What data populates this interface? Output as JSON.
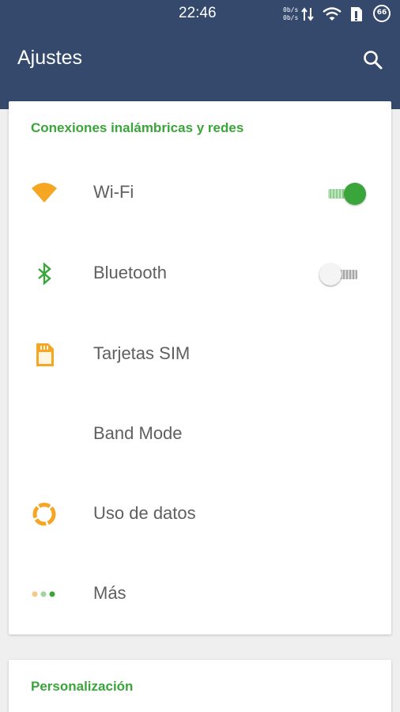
{
  "status_bar": {
    "time": "22:46",
    "net_up": "0b/s",
    "net_down": "0b/s",
    "battery": "66"
  },
  "app_bar": {
    "title": "Ajustes"
  },
  "sections": [
    {
      "title": "Conexiones inalámbricas y redes",
      "items": [
        {
          "label": "Wi-Fi",
          "icon": "wifi-icon",
          "toggle": "on"
        },
        {
          "label": "Bluetooth",
          "icon": "bluetooth-icon",
          "toggle": "off"
        },
        {
          "label": "Tarjetas SIM",
          "icon": "sim-card-icon"
        },
        {
          "label": "Band Mode",
          "icon": ""
        },
        {
          "label": "Uso de datos",
          "icon": "data-usage-icon"
        },
        {
          "label": "Más",
          "icon": "more-dots-icon"
        }
      ]
    },
    {
      "title": "Personalización",
      "items": []
    }
  ],
  "colors": {
    "app_bar": "#34496b",
    "accent_green": "#3aa53a",
    "icon_orange": "#f5a623"
  }
}
